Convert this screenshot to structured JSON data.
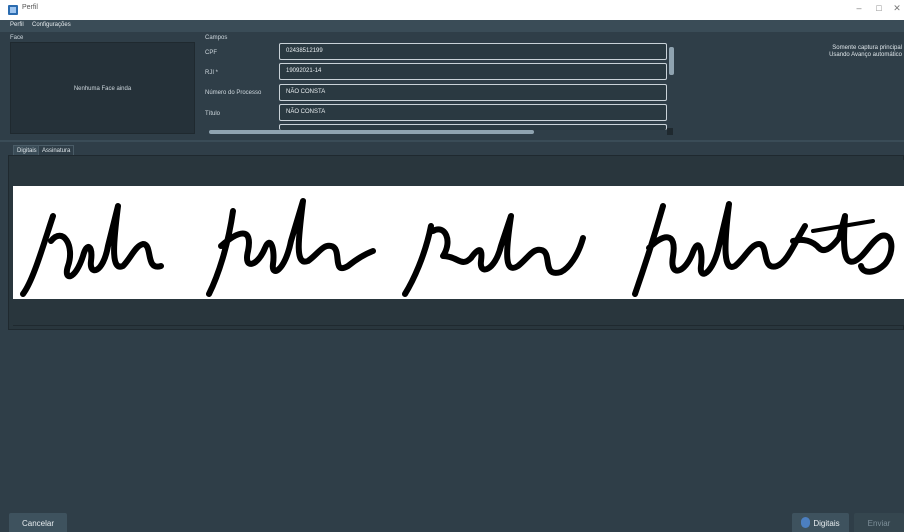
{
  "window": {
    "title": "Perfil",
    "minimize": "–",
    "restore": "□",
    "close": "✕"
  },
  "menu": {
    "items": [
      "Perfil",
      "Configurações"
    ]
  },
  "face": {
    "label": "Face",
    "empty_text": "Nenhuma Face ainda"
  },
  "fields": {
    "label": "Campos",
    "rows": [
      {
        "label": "CPF",
        "value": "02438512199"
      },
      {
        "label": "RJI *",
        "value": "19092021-14"
      },
      {
        "label": "Número do Processo",
        "value": "NÃO CONSTA"
      },
      {
        "label": "Título",
        "value": "NÃO CONSTA"
      }
    ]
  },
  "info": {
    "line1": "Somente captura principal",
    "line2": "Usando Avanço automático"
  },
  "tabs": [
    {
      "label": "Digitais",
      "active": false
    },
    {
      "label": "Assinatura",
      "active": true
    }
  ],
  "footer": {
    "cancel": "Cancelar",
    "digitais": "Digitais",
    "enviar": "Enviar"
  },
  "colors": {
    "background": "#2f3e48",
    "panel": "#29363d",
    "accent": "#4c7fc0"
  },
  "icons": {
    "app": "app-icon",
    "fingerprint": "fingerprint-icon"
  }
}
